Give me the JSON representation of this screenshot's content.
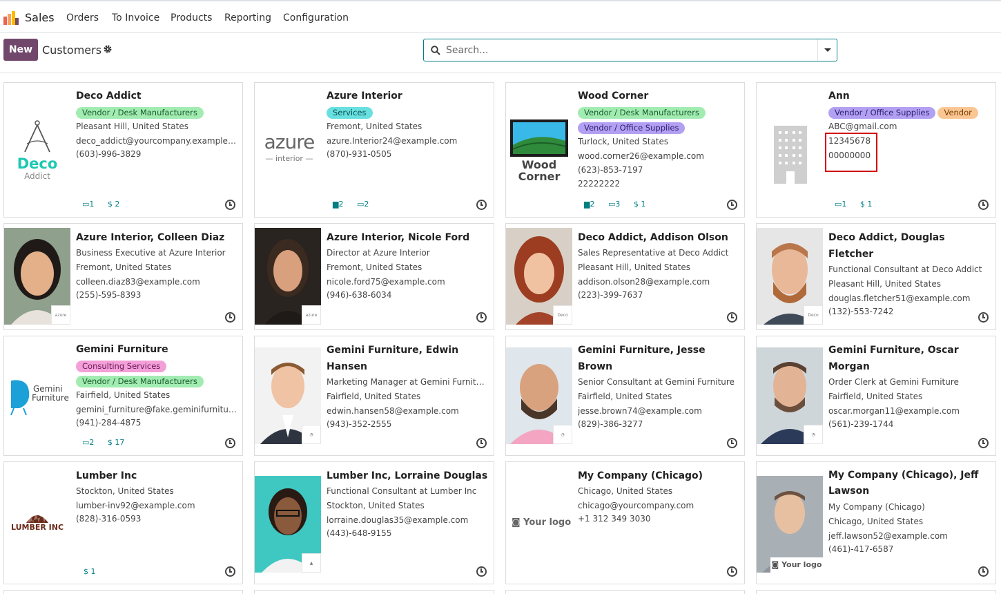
{
  "app": {
    "name": "Sales",
    "menu": [
      "Orders",
      "To Invoice",
      "Products",
      "Reporting",
      "Configuration"
    ]
  },
  "control_panel": {
    "new_label": "New",
    "title": "Customers",
    "search_placeholder": "Search..."
  },
  "colors": {
    "brand": "#71486b",
    "accent": "#017e84",
    "highlight": "#d10000"
  },
  "cards": [
    {
      "name": "Deco Addict",
      "tags": [
        {
          "label": "Vendor / Desk Manufacturers",
          "color": "green"
        }
      ],
      "lines": [
        "Pleasant Hill, United States",
        "deco_addict@yourcompany.example.com",
        "(603)-996-3829"
      ],
      "counters": [
        "1",
        "$ 2"
      ],
      "logo_text": [
        "Deco",
        "Addict"
      ]
    },
    {
      "name": "Azure Interior",
      "tags": [
        {
          "label": "Services",
          "color": "teal"
        }
      ],
      "lines": [
        "Fremont, United States",
        "azure.Interior24@example.com",
        "(870)-931-0505"
      ],
      "counters": [
        "2",
        "2"
      ],
      "logo_text": [
        "azure",
        "interior"
      ]
    },
    {
      "name": "Wood Corner",
      "tags": [
        {
          "label": "Vendor / Desk Manufacturers",
          "color": "green"
        },
        {
          "label": "Vendor / Office Supplies",
          "color": "purple"
        }
      ],
      "lines": [
        "Turlock, United States",
        "wood.corner26@example.com",
        "(623)-853-7197",
        "22222222"
      ],
      "counters": [
        "2",
        "3",
        "$ 1"
      ],
      "logo_text": [
        "Wood",
        "Corner"
      ]
    },
    {
      "name": "Ann",
      "tags": [
        {
          "label": "Vendor / Office Supplies",
          "color": "purple"
        },
        {
          "label": "Vendor",
          "color": "orange"
        }
      ],
      "lines": [
        "ABC@gmail.com",
        "12345678",
        "00000000"
      ],
      "counters": [
        "1",
        "$ 1"
      ]
    },
    {
      "name": "Azure Interior, Colleen Diaz",
      "lines": [
        "Business Executive at Azure Interior",
        "Fremont, United States",
        "colleen.diaz83@example.com",
        "(255)-595-8393"
      ],
      "mini": "azure"
    },
    {
      "name": "Azure Interior, Nicole Ford",
      "lines": [
        "Director at Azure Interior",
        "Fremont, United States",
        "nicole.ford75@example.com",
        "(946)-638-6034"
      ],
      "mini": "azure"
    },
    {
      "name": "Deco Addict, Addison Olson",
      "lines": [
        "Sales Representative at Deco Addict",
        "Pleasant Hill, United States",
        "addison.olson28@example.com",
        "(223)-399-7637"
      ],
      "mini": "Deco"
    },
    {
      "name": "Deco Addict, Douglas Fletcher",
      "lines": [
        "Functional Consultant at Deco Addict",
        "Pleasant Hill, United States",
        "douglas.fletcher51@example.com",
        "(132)-553-7242"
      ],
      "mini": "Deco"
    },
    {
      "name": "Gemini Furniture",
      "tags": [
        {
          "label": "Consulting Services",
          "color": "pink"
        },
        {
          "label": "Vendor / Desk Manufacturers",
          "color": "green"
        }
      ],
      "lines": [
        "Fairfield, United States",
        "gemini_furniture@fake.geminifurniture.com",
        "(941)-284-4875"
      ],
      "counters": [
        "2",
        "$ 17"
      ],
      "logo_text": [
        "Gemini",
        "Furniture"
      ]
    },
    {
      "name": "Gemini Furniture, Edwin Hansen",
      "lines": [
        "Marketing Manager at Gemini Furniture",
        "Fairfield, United States",
        "edwin.hansen58@example.com",
        "(943)-352-2555"
      ]
    },
    {
      "name": "Gemini Furniture, Jesse Brown",
      "lines": [
        "Senior Consultant at Gemini Furniture",
        "Fairfield, United States",
        "jesse.brown74@example.com",
        "(829)-386-3277"
      ]
    },
    {
      "name": "Gemini Furniture, Oscar Morgan",
      "lines": [
        "Order Clerk at Gemini Furniture",
        "Fairfield, United States",
        "oscar.morgan11@example.com",
        "(561)-239-1744"
      ]
    },
    {
      "name": "Lumber Inc",
      "lines": [
        "Stockton, United States",
        "lumber-inv92@example.com",
        "(828)-316-0593"
      ],
      "counters": [
        "$ 1"
      ],
      "logo_text": [
        "LUMBER INC"
      ]
    },
    {
      "name": "Lumber Inc, Lorraine Douglas",
      "lines": [
        "Functional Consultant at Lumber Inc",
        "Stockton, United States",
        "lorraine.douglas35@example.com",
        "(443)-648-9155"
      ]
    },
    {
      "name": "My Company (Chicago)",
      "lines": [
        "Chicago, United States",
        "chicago@yourcompany.com",
        "+1 312 349 3030"
      ],
      "logo_text": [
        "Your logo"
      ]
    },
    {
      "name": "My Company (Chicago), Jeff Lawson",
      "lines": [
        "My Company (Chicago)",
        "Chicago, United States",
        "jeff.lawson52@example.com",
        "(461)-417-6587"
      ],
      "logo_text": [
        "Your logo"
      ]
    }
  ]
}
